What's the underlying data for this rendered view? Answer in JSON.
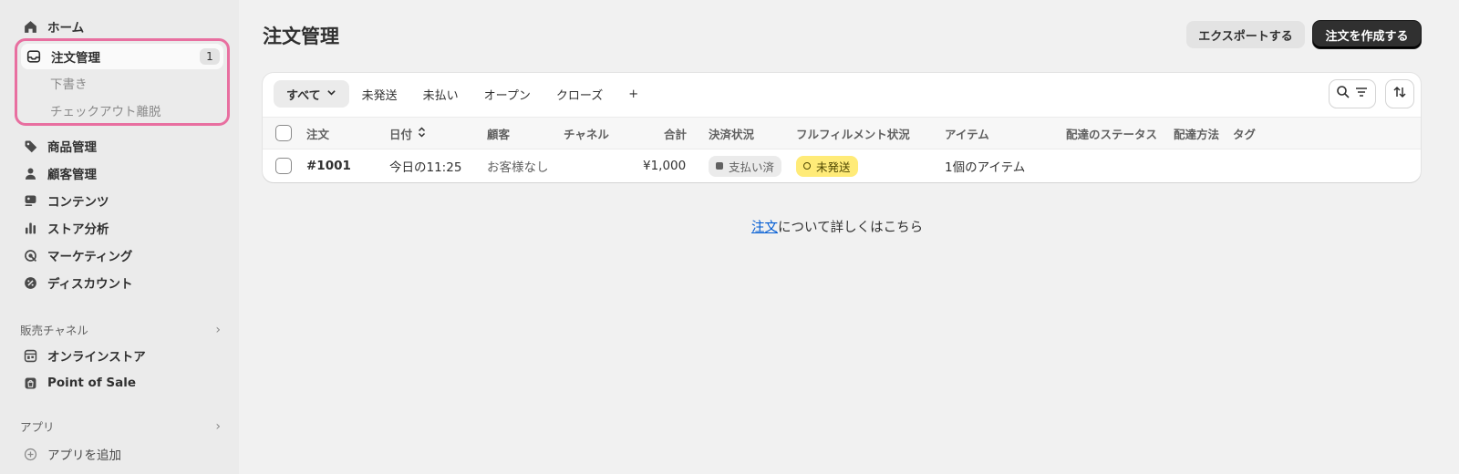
{
  "sidebar": {
    "home": "ホーム",
    "orders": "注文管理",
    "orders_count": "1",
    "drafts": "下書き",
    "abandoned": "チェックアウト離脱",
    "products": "商品管理",
    "customers": "顧客管理",
    "content": "コンテンツ",
    "analytics": "ストア分析",
    "marketing": "マーケティング",
    "discounts": "ディスカウント",
    "sales_channels_label": "販売チャネル",
    "online_store": "オンラインストア",
    "pos": "Point of Sale",
    "apps_label": "アプリ",
    "add_app": "アプリを追加"
  },
  "header": {
    "title": "注文管理",
    "export_label": "エクスポートする",
    "create_label": "注文を作成する"
  },
  "tabs": [
    "すべて",
    "未発送",
    "未払い",
    "オープン",
    "クローズ",
    "+"
  ],
  "table": {
    "columns": [
      "注文",
      "日付",
      "顧客",
      "チャネル",
      "合計",
      "決済状況",
      "フルフィルメント状況",
      "アイテム",
      "配達のステータス",
      "配達方法",
      "タグ"
    ],
    "rows": [
      {
        "order": "#1001",
        "date": "今日の11:25",
        "customer": "お客様なし",
        "channel": "",
        "total": "¥1,000",
        "payment": "支払い済",
        "fulfillment": "未発送",
        "items": "1個のアイテム",
        "delivery_status": "",
        "delivery_method": "",
        "tags": ""
      }
    ]
  },
  "footer": {
    "link": "注文",
    "text": "について詳しくはこちら"
  },
  "colors": {
    "highlight_border": "#e86fa0",
    "primary_button": "#303030",
    "unfulfilled_badge": "#ffeb78",
    "paid_badge": "#ebebeb",
    "link": "#005bd3"
  }
}
